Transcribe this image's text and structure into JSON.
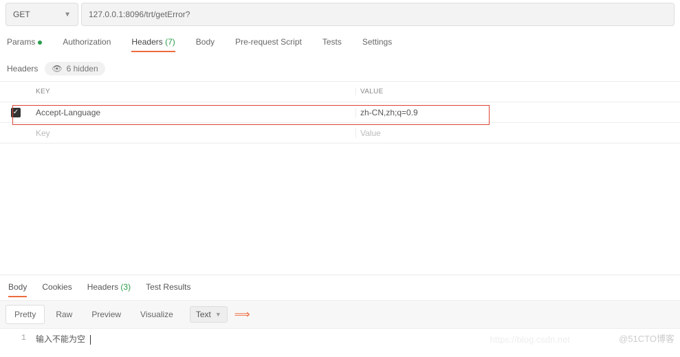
{
  "request": {
    "method": "GET",
    "url": "127.0.0.1:8096/trt/getError?"
  },
  "tabs": {
    "params": "Params",
    "auth": "Authorization",
    "headers": "Headers",
    "headers_count": "(7)",
    "body": "Body",
    "prescript": "Pre-request Script",
    "tests": "Tests",
    "settings": "Settings"
  },
  "headers_section": {
    "title": "Headers",
    "hidden_pill": "6 hidden",
    "col_key": "Key",
    "col_val": "Value",
    "row1_key": "Accept-Language",
    "row1_val": "zh-CN,zh;q=0.9",
    "ph_key": "Key",
    "ph_val": "Value"
  },
  "response": {
    "tabs": {
      "body": "Body",
      "cookies": "Cookies",
      "headers": "Headers",
      "headers_count": "(3)",
      "tests": "Test Results"
    },
    "toolbar": {
      "pretty": "Pretty",
      "raw": "Raw",
      "preview": "Preview",
      "visualize": "Visualize",
      "type": "Text"
    },
    "line_no": "1",
    "body_text": "输入不能为空"
  },
  "watermark": "@51CTO博客",
  "watermark2": "https://blog.csdn.net"
}
